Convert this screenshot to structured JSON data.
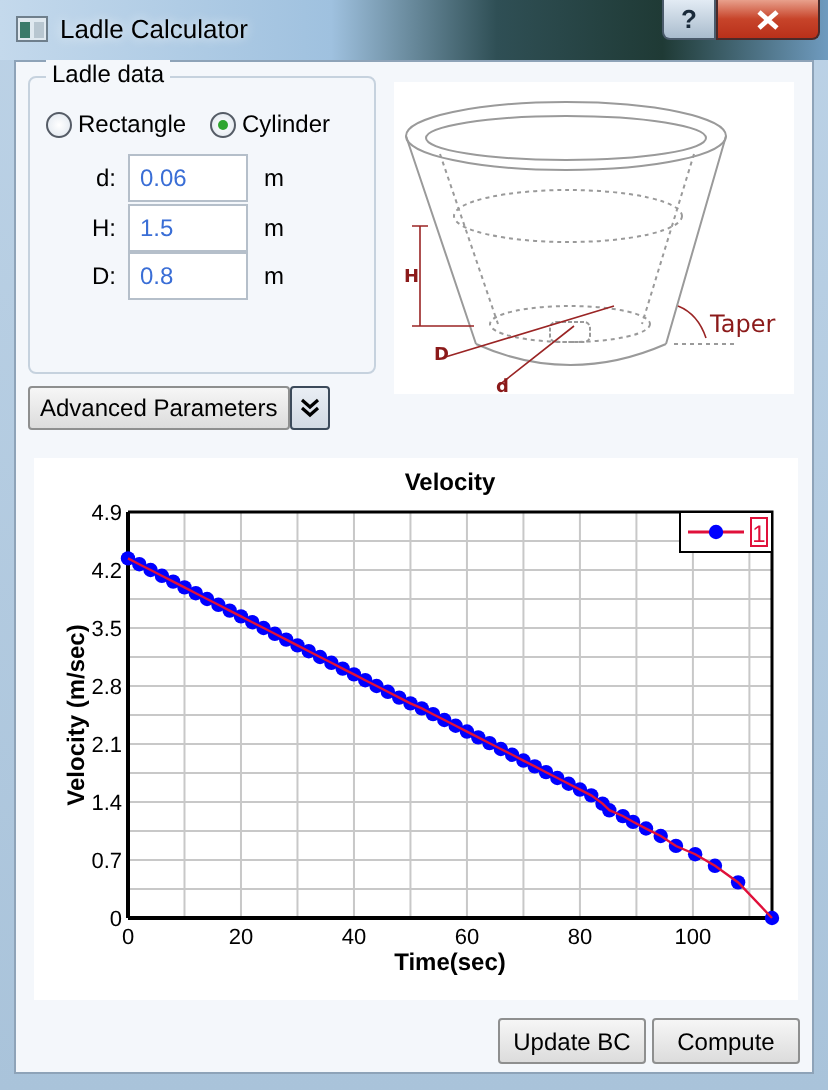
{
  "window": {
    "title": "Ladle Calculator",
    "help_button": "?"
  },
  "ladle_data": {
    "title": "Ladle data",
    "shapes": [
      {
        "label": "Rectangle",
        "selected": false
      },
      {
        "label": "Cylinder",
        "selected": true
      }
    ],
    "fields": [
      {
        "label": "d:",
        "value": "0.06",
        "unit": "m"
      },
      {
        "label": "H:",
        "value": "1.5",
        "unit": "m"
      },
      {
        "label": "D:",
        "value": "0.8",
        "unit": "m"
      }
    ]
  },
  "advanced_button": "Advanced Parameters",
  "diagram": {
    "labels": [
      "H",
      "D",
      "d",
      "Taper"
    ]
  },
  "chart": {
    "chart_data": {
      "type": "line",
      "title": "Velocity",
      "xlabel": "Time(sec)",
      "ylabel": "Velocity (m/sec)",
      "x": [
        0,
        2,
        4,
        6,
        8,
        10,
        12,
        14,
        16,
        18,
        20,
        22,
        24,
        26,
        28,
        30,
        32,
        34,
        36,
        38,
        40,
        42,
        44,
        46,
        48,
        50,
        52,
        54,
        56,
        58,
        60,
        62,
        64,
        66,
        68,
        70,
        72,
        74,
        76,
        78,
        80,
        82,
        84,
        85.2,
        87.6,
        89.4,
        91.7,
        94.3,
        97,
        100.4,
        103.9,
        108,
        114
      ],
      "series": [
        {
          "name": "1",
          "color": "#e0103a",
          "marker": "circle",
          "values": [
            4.34,
            4.27,
            4.2,
            4.13,
            4.06,
            3.99,
            3.92,
            3.85,
            3.78,
            3.71,
            3.64,
            3.57,
            3.5,
            3.43,
            3.36,
            3.29,
            3.22,
            3.15,
            3.08,
            3.01,
            2.94,
            2.87,
            2.8,
            2.73,
            2.66,
            2.59,
            2.53,
            2.46,
            2.39,
            2.32,
            2.25,
            2.18,
            2.11,
            2.04,
            1.97,
            1.9,
            1.83,
            1.76,
            1.69,
            1.62,
            1.55,
            1.48,
            1.38,
            1.3,
            1.23,
            1.16,
            1.08,
            0.99,
            0.87,
            0.77,
            0.63,
            0.43,
            0
          ]
        }
      ],
      "xlim": [
        0,
        114
      ],
      "ylim": [
        0,
        4.9
      ],
      "xticks": [
        0,
        20,
        40,
        60,
        80,
        100
      ],
      "yticks": [
        0,
        0.7,
        1.4,
        2.1,
        2.8,
        3.5,
        4.2,
        4.9
      ],
      "grid": true
    }
  },
  "buttons": [
    "Update BC",
    "Compute"
  ]
}
